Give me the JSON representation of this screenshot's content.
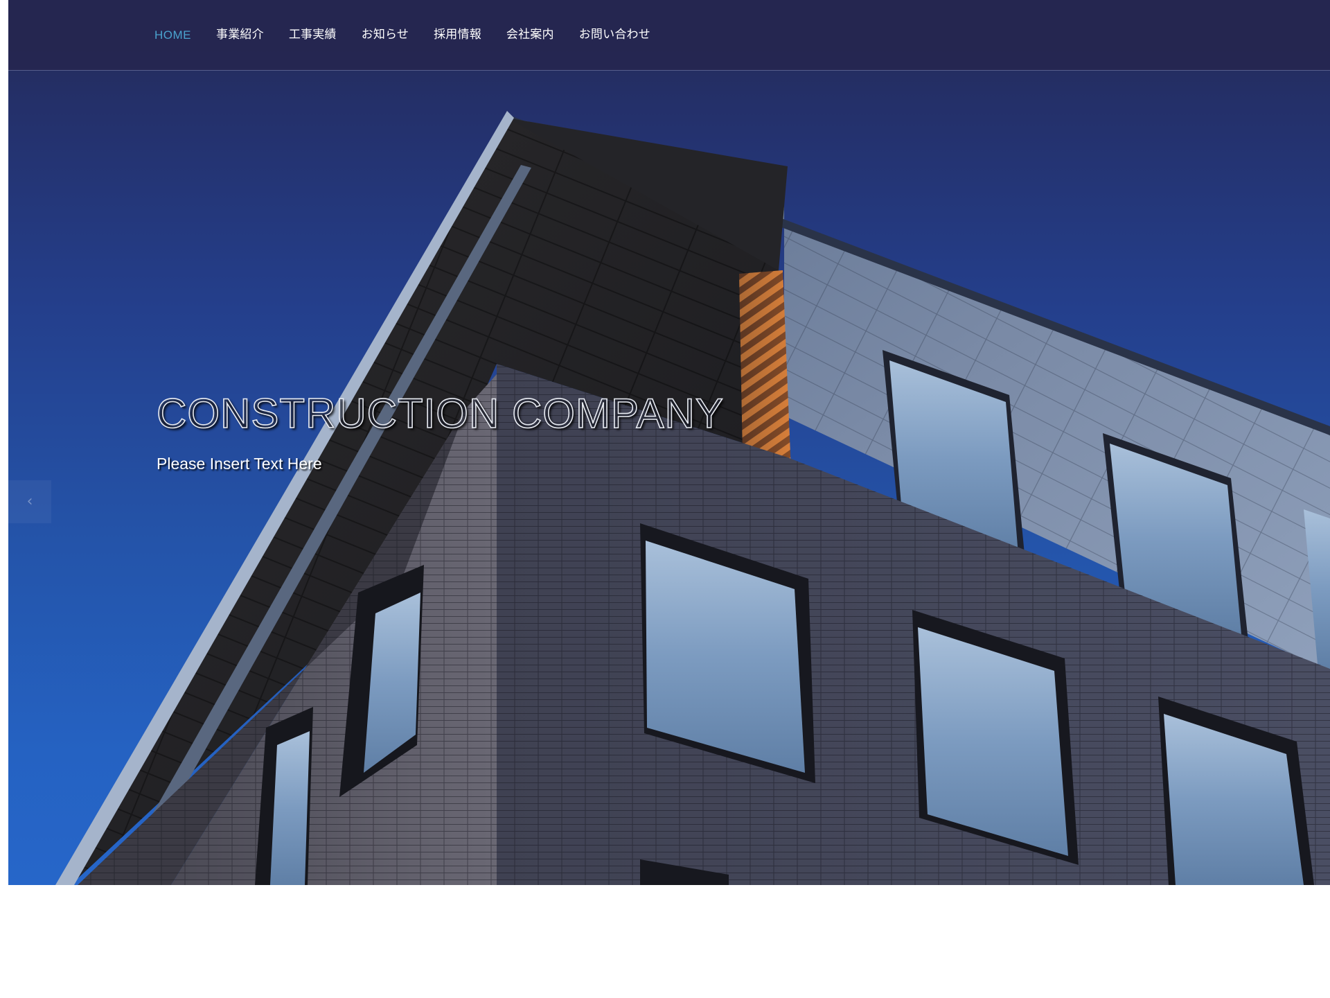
{
  "nav": {
    "items": [
      {
        "label": "HOME",
        "active": true
      },
      {
        "label": "事業紹介",
        "active": false
      },
      {
        "label": "工事実績",
        "active": false
      },
      {
        "label": "お知らせ",
        "active": false
      },
      {
        "label": "採用情報",
        "active": false
      },
      {
        "label": "会社案内",
        "active": false
      },
      {
        "label": "お問い合わせ",
        "active": false
      }
    ]
  },
  "hero": {
    "title": "CONSTRUCTION COMPANY",
    "subtitle": "Please Insert Text Here",
    "image": "building-facade-photo",
    "prev_icon": "chevron-left-icon",
    "prev_glyph": "‹"
  },
  "colors": {
    "header_bg": "#252650",
    "nav_active": "#4aa3cf",
    "nav_text": "#ffffff",
    "sky_top": "#252a52",
    "sky_bottom": "#2666c9",
    "page_bg": "#ffffff"
  }
}
